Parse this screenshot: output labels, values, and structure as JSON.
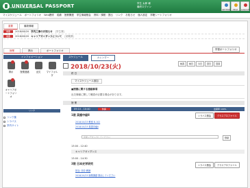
{
  "header": {
    "logo_text": "UNIVERSAL PASSPORT",
    "logo_sub": "Campus Information System",
    "user_line1": "学生 太郎 様",
    "user_line2": "最終ログイン",
    "buttons": [
      {
        "label": "SETTING",
        "icon": "gear-icon",
        "color": "#3a7fc1"
      },
      {
        "label": "HELP",
        "icon": "help-icon",
        "color": "#e2a21a"
      },
      {
        "label": "LOGOUT",
        "icon": "logout-icon",
        "color": "#c33"
      }
    ]
  },
  "menu": [
    "マイスケジュール",
    "ポートフォリオ",
    "Web履修",
    "成績",
    "授業関連",
    "学生情報照会",
    "資料・課題・提出",
    "リンク",
    "お知らせ",
    "個人設定",
    "学籍シートフォリオ"
  ],
  "notice_tabs": [
    "重要",
    "最新情報"
  ],
  "notices": [
    {
      "badge": "重要",
      "date": "2018/08/20",
      "text": "学内工事のお知らせ",
      "source": "[学生課]"
    },
    {
      "badge": "重要",
      "date": "2018/08/20",
      "text": "キャリアガイダンスについて",
      "source": "[就職課]"
    }
  ],
  "content_tabs": [
    "授業",
    "掲示",
    "ポートフォリオ"
  ],
  "portal_button": "学習ポートフォリオ",
  "left": {
    "header": "インフォメーション",
    "footer": "リンク",
    "icons": [
      {
        "label": "掲示",
        "name": "bulletin",
        "dot": true
      },
      {
        "label": "授業連絡",
        "name": "class-notice",
        "dot": true
      },
      {
        "label": "出欠",
        "name": "attendance",
        "dot": false
      },
      {
        "label": "マイフォルダ",
        "name": "folder",
        "dot": false
      },
      {
        "label": "キャリアポートフォリオ",
        "name": "career",
        "dot": true
      }
    ],
    "links": [
      "リンク集",
      "シラバス",
      "学内サイト"
    ]
  },
  "right": {
    "tab_active": "スケジュール",
    "tab_alt": "カレンダー",
    "date": "2018/10/23(火)",
    "nav": [
      "前週",
      "前日",
      "今日",
      "翌日",
      "翌週"
    ],
    "section_today": "終 日",
    "my_schedule_btn": "マイスケジュール追加",
    "notice_title": "■授業に関する連絡事項",
    "notice_line": "出欠情報に関して確認が必要な場合があります。",
    "schedule_header": "授 業",
    "slot1_time": "09:10 - 10:40",
    "slot1_tag": "休講",
    "slot1_progress": "出席率 100%",
    "course1": "1限 英語中級Ⅱ",
    "course1_meta1": "2018/10/23 教室 B-102",
    "course1_meta2": "2018/10/23 英語中級Ⅱ",
    "course1_btn1": "シラバス照会",
    "course1_btn2": "クラスプロファイル",
    "input_placeholder": "授業メモを入力してください",
    "input_btn": "登録",
    "slot2_time": "13:00 - 12:40",
    "career": "キャリアガイダンス",
    "slot3_time": "13:00 - 14:30",
    "course3": "3限 日本史学研究",
    "course3_meta1": "担当: 田中 教授",
    "course3_meta2": "2018/10/23 授業課題 提出してください",
    "course3_btn1": "シラバス照会",
    "course3_btn2": "クラスプロファイル"
  }
}
